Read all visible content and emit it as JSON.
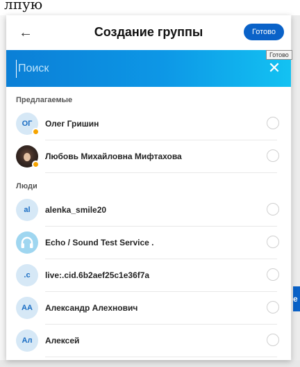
{
  "background": {
    "top_text": "лпую"
  },
  "dialog": {
    "title": "Создание группы",
    "done_label": "Готово",
    "tooltip": "Готово",
    "search": {
      "placeholder": "Поиск",
      "value": ""
    }
  },
  "sections": [
    {
      "label": "Предлагаемые",
      "contacts": [
        {
          "initials": "ОГ",
          "name": "Олег Гришин",
          "status": "away",
          "avatar": "initials"
        },
        {
          "initials": "",
          "name": "Любовь Михайловна Мифтахова",
          "status": "away",
          "avatar": "photo"
        }
      ]
    },
    {
      "label": "Люди",
      "contacts": [
        {
          "initials": "al",
          "name": "alenka_smile20",
          "avatar": "initials"
        },
        {
          "initials": "",
          "name": "Echo / Sound Test Service .",
          "avatar": "echo"
        },
        {
          "initials": ".c",
          "name": "live:.cid.6b2aef25c1e36f7a",
          "avatar": "initials"
        },
        {
          "initials": "АА",
          "name": "Александр Алехнович",
          "avatar": "initials"
        },
        {
          "initials": "Ал",
          "name": "Алексей",
          "avatar": "initials"
        }
      ]
    }
  ],
  "colors": {
    "accent": "#0a62c8",
    "search_gradient_start": "#0b7fd6",
    "search_gradient_end": "#13c2f2",
    "status_away": "#f6a400"
  }
}
